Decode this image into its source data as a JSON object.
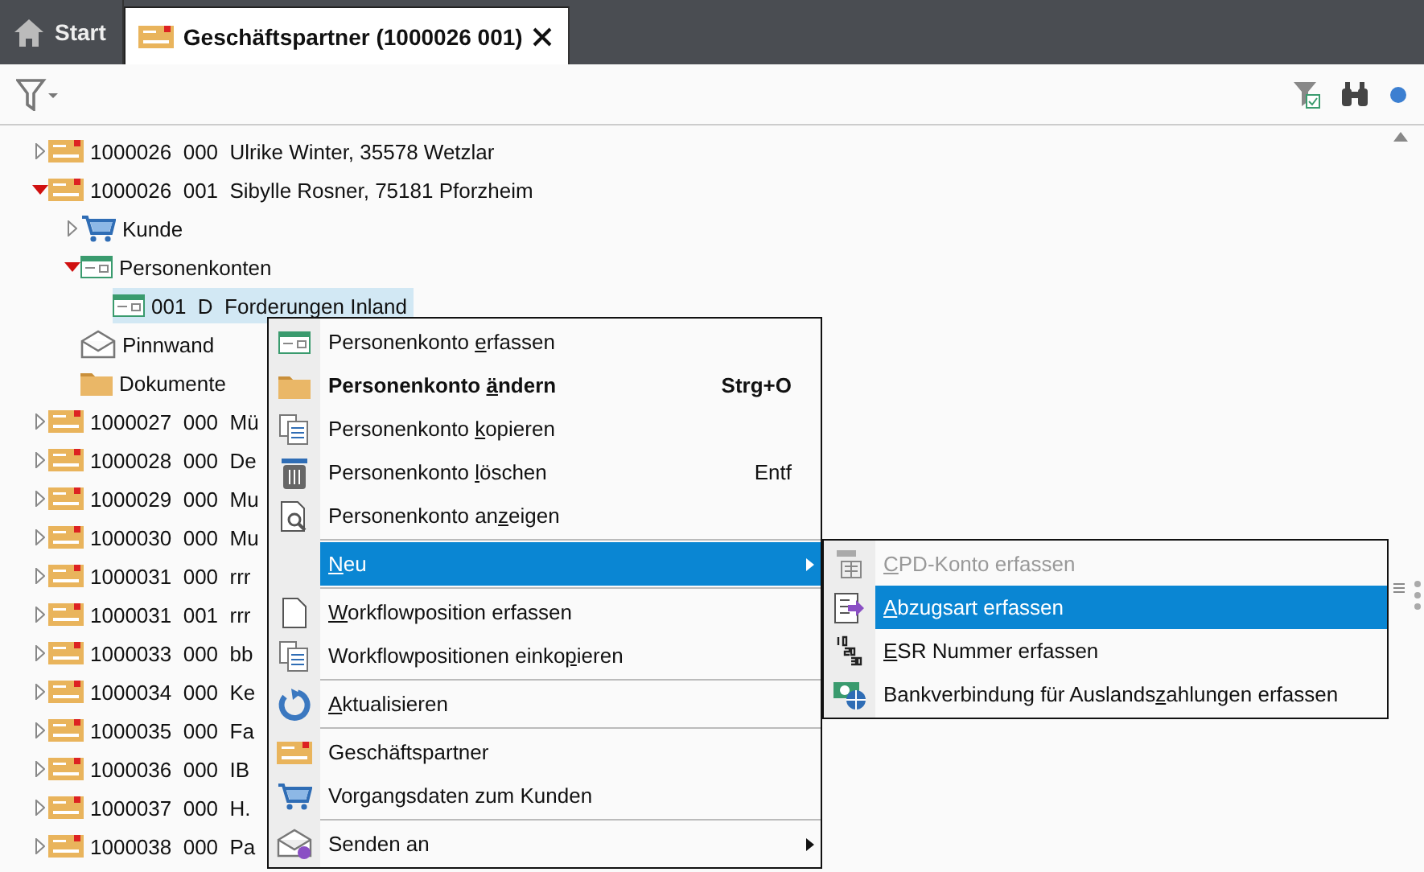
{
  "tabs": [
    {
      "label": "Start",
      "kind": "home",
      "selected": false,
      "closable": false
    },
    {
      "label": "Geschäftspartner (1000026 001)",
      "kind": "partner",
      "selected": true,
      "closable": true
    }
  ],
  "tree": [
    {
      "kind": "partner",
      "code": "1000026",
      "sub": "000",
      "name": "Ulrike Winter, 35578 Wetzlar",
      "expanded": false,
      "selected": false
    },
    {
      "kind": "partner",
      "code": "1000026",
      "sub": "001",
      "name": "Sibylle Rosner, 75181 Pforzheim",
      "expanded": true,
      "selected": false,
      "children": [
        {
          "kind": "cart",
          "name": "Kunde",
          "expanded": false,
          "selected": false
        },
        {
          "kind": "account",
          "name": "Personenkonten",
          "expanded": true,
          "selected": false,
          "children": [
            {
              "kind": "account",
              "code": "001",
              "sub": "D",
              "name": "Forderungen Inland",
              "selected": true
            }
          ]
        },
        {
          "kind": "mail",
          "name": "Pinnwand",
          "selected": false
        },
        {
          "kind": "folder",
          "name": "Dokumente",
          "selected": false
        }
      ]
    },
    {
      "kind": "partner",
      "code": "1000027",
      "sub": "000",
      "name": "Mü",
      "expanded": false,
      "selected": false
    },
    {
      "kind": "partner",
      "code": "1000028",
      "sub": "000",
      "name": "De",
      "expanded": false,
      "selected": false
    },
    {
      "kind": "partner",
      "code": "1000029",
      "sub": "000",
      "name": "Mu",
      "expanded": false,
      "selected": false
    },
    {
      "kind": "partner",
      "code": "1000030",
      "sub": "000",
      "name": "Mu",
      "expanded": false,
      "selected": false
    },
    {
      "kind": "partner",
      "code": "1000031",
      "sub": "000",
      "name": "rrr",
      "expanded": false,
      "selected": false
    },
    {
      "kind": "partner",
      "code": "1000031",
      "sub": "001",
      "name": "rrr",
      "expanded": false,
      "selected": false
    },
    {
      "kind": "partner",
      "code": "1000033",
      "sub": "000",
      "name": "bb",
      "expanded": false,
      "selected": false
    },
    {
      "kind": "partner",
      "code": "1000034",
      "sub": "000",
      "name": "Ke",
      "expanded": false,
      "selected": false
    },
    {
      "kind": "partner",
      "code": "1000035",
      "sub": "000",
      "name": "Fa",
      "expanded": false,
      "selected": false
    },
    {
      "kind": "partner",
      "code": "1000036",
      "sub": "000",
      "name": "IB",
      "expanded": false,
      "selected": false
    },
    {
      "kind": "partner",
      "code": "1000037",
      "sub": "000",
      "name": "H.",
      "expanded": false,
      "selected": false
    },
    {
      "kind": "partner",
      "code": "1000038",
      "sub": "000",
      "name": "Pa",
      "expanded": false,
      "selected": false
    }
  ],
  "context_menu": [
    {
      "kind": "account",
      "label": [
        {
          "text": "Personenkonto ",
          "underline": false
        },
        {
          "text": "e",
          "underline": true
        },
        {
          "text": "rfassen",
          "underline": false
        }
      ],
      "bold": false,
      "submenu": false,
      "selected": false
    },
    {
      "kind": "folder",
      "label": [
        {
          "text": "Personenkonto ",
          "underline": false
        },
        {
          "text": "ä",
          "underline": true
        },
        {
          "text": "ndern",
          "underline": false
        }
      ],
      "bold": true,
      "shortcut": "Strg+O",
      "submenu": false,
      "selected": false
    },
    {
      "kind": "copy",
      "label": [
        {
          "text": "Personenkonto ",
          "underline": false
        },
        {
          "text": "k",
          "underline": true
        },
        {
          "text": "opieren",
          "underline": false
        }
      ],
      "bold": false,
      "submenu": false,
      "selected": false
    },
    {
      "kind": "trash",
      "label": [
        {
          "text": "Personenkonto ",
          "underline": false
        },
        {
          "text": "l",
          "underline": true
        },
        {
          "text": "öschen",
          "underline": false
        }
      ],
      "bold": false,
      "shortcut": "Entf",
      "submenu": false,
      "selected": false
    },
    {
      "kind": "preview",
      "label": [
        {
          "text": "Personenkonto an",
          "underline": false
        },
        {
          "text": "z",
          "underline": true
        },
        {
          "text": "eigen",
          "underline": false
        }
      ],
      "bold": false,
      "submenu": false,
      "selected": false
    },
    {
      "kind": "separator"
    },
    {
      "kind": "plain",
      "label": [
        {
          "text": "N",
          "underline": true
        },
        {
          "text": "eu",
          "underline": false
        }
      ],
      "bold": false,
      "submenu": true,
      "selected": true
    },
    {
      "kind": "separator"
    },
    {
      "kind": "doc",
      "label": [
        {
          "text": "W",
          "underline": true
        },
        {
          "text": "orkflowposition erfassen",
          "underline": false
        }
      ],
      "bold": false,
      "submenu": false,
      "selected": false
    },
    {
      "kind": "copy",
      "label": [
        {
          "text": "Workflowpositionen einko",
          "underline": false
        },
        {
          "text": "p",
          "underline": true
        },
        {
          "text": "ieren",
          "underline": false
        }
      ],
      "bold": false,
      "submenu": false,
      "selected": false
    },
    {
      "kind": "separator"
    },
    {
      "kind": "refresh",
      "label": [
        {
          "text": "A",
          "underline": true
        },
        {
          "text": "ktualisieren",
          "underline": false
        }
      ],
      "bold": false,
      "submenu": false,
      "selected": false
    },
    {
      "kind": "separator"
    },
    {
      "kind": "partner",
      "label": [
        {
          "text": "Geschäftspartner",
          "underline": false
        }
      ],
      "bold": false,
      "submenu": false,
      "selected": false
    },
    {
      "kind": "cart",
      "label": [
        {
          "text": "Vorgangsdaten zum Kunden",
          "underline": false
        }
      ],
      "bold": false,
      "submenu": false,
      "selected": false
    },
    {
      "kind": "separator"
    },
    {
      "kind": "send",
      "label": [
        {
          "text": "Senden an",
          "underline": false
        }
      ],
      "bold": false,
      "submenu": true,
      "selected": false
    }
  ],
  "submenu": [
    {
      "kind": "cpd",
      "label": [
        {
          "text": "C",
          "underline": true
        },
        {
          "text": "PD-Konto erfassen",
          "underline": false
        }
      ],
      "disabled": true,
      "selected": false
    },
    {
      "kind": "deduction",
      "label": [
        {
          "text": "A",
          "underline": true
        },
        {
          "text": "bzugsart erfassen",
          "underline": false
        }
      ],
      "disabled": false,
      "selected": true
    },
    {
      "kind": "esr",
      "label": [
        {
          "text": "E",
          "underline": true
        },
        {
          "text": "SR Nummer erfassen",
          "underline": false
        }
      ],
      "disabled": false,
      "selected": false
    },
    {
      "kind": "bank",
      "label": [
        {
          "text": "Bankverbindung für Auslands",
          "underline": false
        },
        {
          "text": "z",
          "underline": true
        },
        {
          "text": "ahlungen erfassen",
          "underline": false
        }
      ],
      "disabled": false,
      "selected": false
    }
  ]
}
